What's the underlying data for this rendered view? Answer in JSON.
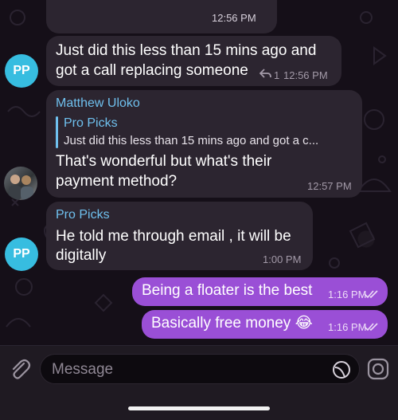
{
  "messages": {
    "m0": {
      "time": "12:56 PM"
    },
    "m1": {
      "avatar": "PP",
      "line1": "Just did this less than 15 mins ago and",
      "line2": "got a call replacing someone",
      "reply_count": "1",
      "time": "12:56 PM"
    },
    "m2": {
      "sender": "Matthew Uloko",
      "reply_name": "Pro Picks",
      "reply_text": "Just did this less than 15 mins ago and got a c...",
      "line1": "That's wonderful but what's their",
      "line2": "payment method?",
      "time": "12:57 PM"
    },
    "m3": {
      "sender": "Pro Picks",
      "avatar": "PP",
      "line1": "He told me through email , it will be",
      "line2": "digitally",
      "time": "1:00 PM"
    },
    "m4": {
      "text": "Being a floater is the best",
      "time": "1:16 PM"
    },
    "m5": {
      "text": "Basically free money 😂",
      "time": "1:16 PM"
    }
  },
  "composer": {
    "placeholder": "Message"
  },
  "colors": {
    "incoming_bubble": "#2c2530",
    "outgoing_bubble": "#9a4fd6",
    "accent_name": "#6fc0ee",
    "avatar_bg": "#37bde0",
    "background": "#150f18"
  },
  "icons": [
    "reply-arrow-icon",
    "double-check-icon",
    "paperclip-icon",
    "sticker-icon",
    "camera-icon"
  ]
}
